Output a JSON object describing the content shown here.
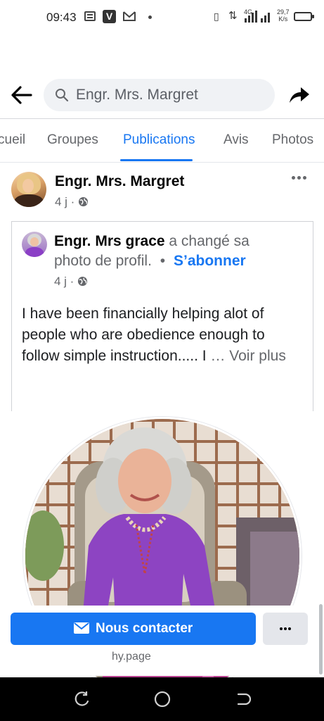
{
  "status_bar": {
    "time": "09:43",
    "network": "4G",
    "speed_value": "29,7",
    "speed_unit": "K/s"
  },
  "header": {
    "search_text": "Engr. Mrs. Margret"
  },
  "tabs": [
    {
      "label": "cueil",
      "active": false
    },
    {
      "label": "Groupes",
      "active": false
    },
    {
      "label": "Publications",
      "active": true
    },
    {
      "label": "Avis",
      "active": false
    },
    {
      "label": "Photos",
      "active": false
    }
  ],
  "post": {
    "author": "Engr. Mrs. Margret",
    "time": "4 j ·",
    "shared": {
      "name": "Engr. Mrs grace",
      "action_part1": "a changé sa",
      "action_part2": "photo de profil.",
      "separator": "•",
      "follow_label": "S’abonner",
      "time": "4 j ·",
      "body_text": "I have been financially helping alot of people who are obedience enough to follow simple instruction..... I",
      "see_more": "… Voir plus"
    }
  },
  "cta": {
    "contact_label": "Nous contacter",
    "domain": "hy.page"
  },
  "colors": {
    "accent": "#1877f2",
    "secondary_text": "#65676b",
    "surface": "#f0f2f5"
  },
  "icons": [
    "back-arrow-icon",
    "search-icon",
    "share-icon",
    "globe-icon",
    "more-icon",
    "envelope-icon",
    "recents-icon",
    "home-icon",
    "back-nav-icon"
  ]
}
